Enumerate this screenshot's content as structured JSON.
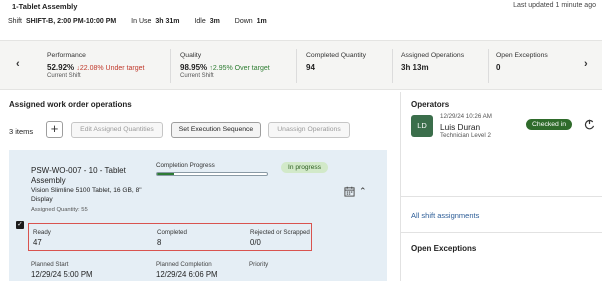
{
  "header": {
    "title": "1-Tablet Assembly",
    "updated": "Last updated 1 minute ago",
    "shift_label": "Shift",
    "shift_value": "SHIFT-B, 2:00 PM-10:00 PM",
    "inuse_label": "In Use",
    "inuse_value": "3h 31m",
    "idle_label": "Idle",
    "idle_value": "3m",
    "down_label": "Down",
    "down_value": "1m"
  },
  "metrics": [
    {
      "label": "Performance",
      "value": "52.92%",
      "delta": "22.08% Under target",
      "delta_dir": "down",
      "sub": "Current Shift"
    },
    {
      "label": "Quality",
      "value": "98.95%",
      "delta": "2.95% Over target",
      "delta_dir": "up",
      "sub": "Current Shift"
    },
    {
      "label": "Completed Quantity",
      "value": "94"
    },
    {
      "label": "Assigned Operations",
      "value": "3h 13m"
    },
    {
      "label": "Open Exceptions",
      "value": "0"
    }
  ],
  "nav": {
    "prev_icon": "chevron-left-icon",
    "next_icon": "chevron-right-icon"
  },
  "operations": {
    "title": "Assigned work order operations",
    "count": "3 items",
    "buttons": {
      "add": "+",
      "edit": "Edit Assigned Quantities",
      "sequence": "Set Execution Sequence",
      "unassign": "Unassign Operations"
    },
    "card": {
      "name": "PSW-WO-007 - 10 - Tablet Assembly",
      "description": "Vision Slimline 5100 Tablet, 16 GB, 8\" Display",
      "assigned_quantity": "Assigned Quantity: 55",
      "progress_label": "Completion Progress",
      "progress": 0.15,
      "status": "In progress",
      "selected": true,
      "stats": [
        {
          "label": "Ready",
          "value": "47"
        },
        {
          "label": "Completed",
          "value": "8"
        },
        {
          "label": "Rejected or Scrapped",
          "value": "0/0"
        }
      ],
      "plan": [
        {
          "label": "Planned Start",
          "value": "12/29/24 5:00 PM"
        },
        {
          "label": "Planned Completion",
          "value": "12/29/24 6:06 PM"
        },
        {
          "label": "Priority",
          "value": ""
        }
      ]
    }
  },
  "operators": {
    "title": "Operators",
    "person": {
      "initials": "LD",
      "time": "12/29/24 10:26 AM",
      "name": "Luis Duran",
      "level": "Technician Level 2",
      "status": "Checked in"
    },
    "link": "All shift assignments",
    "exceptions_title": "Open Exceptions"
  },
  "colors": {
    "accent_link": "#2c5d97",
    "down": "#c0392b",
    "up": "#2e7d32",
    "badge_bg": "#d2e9c9",
    "checked_bg": "#2f6b2b",
    "card_bg": "#e5eef5",
    "highlight_border": "#d9534f"
  }
}
